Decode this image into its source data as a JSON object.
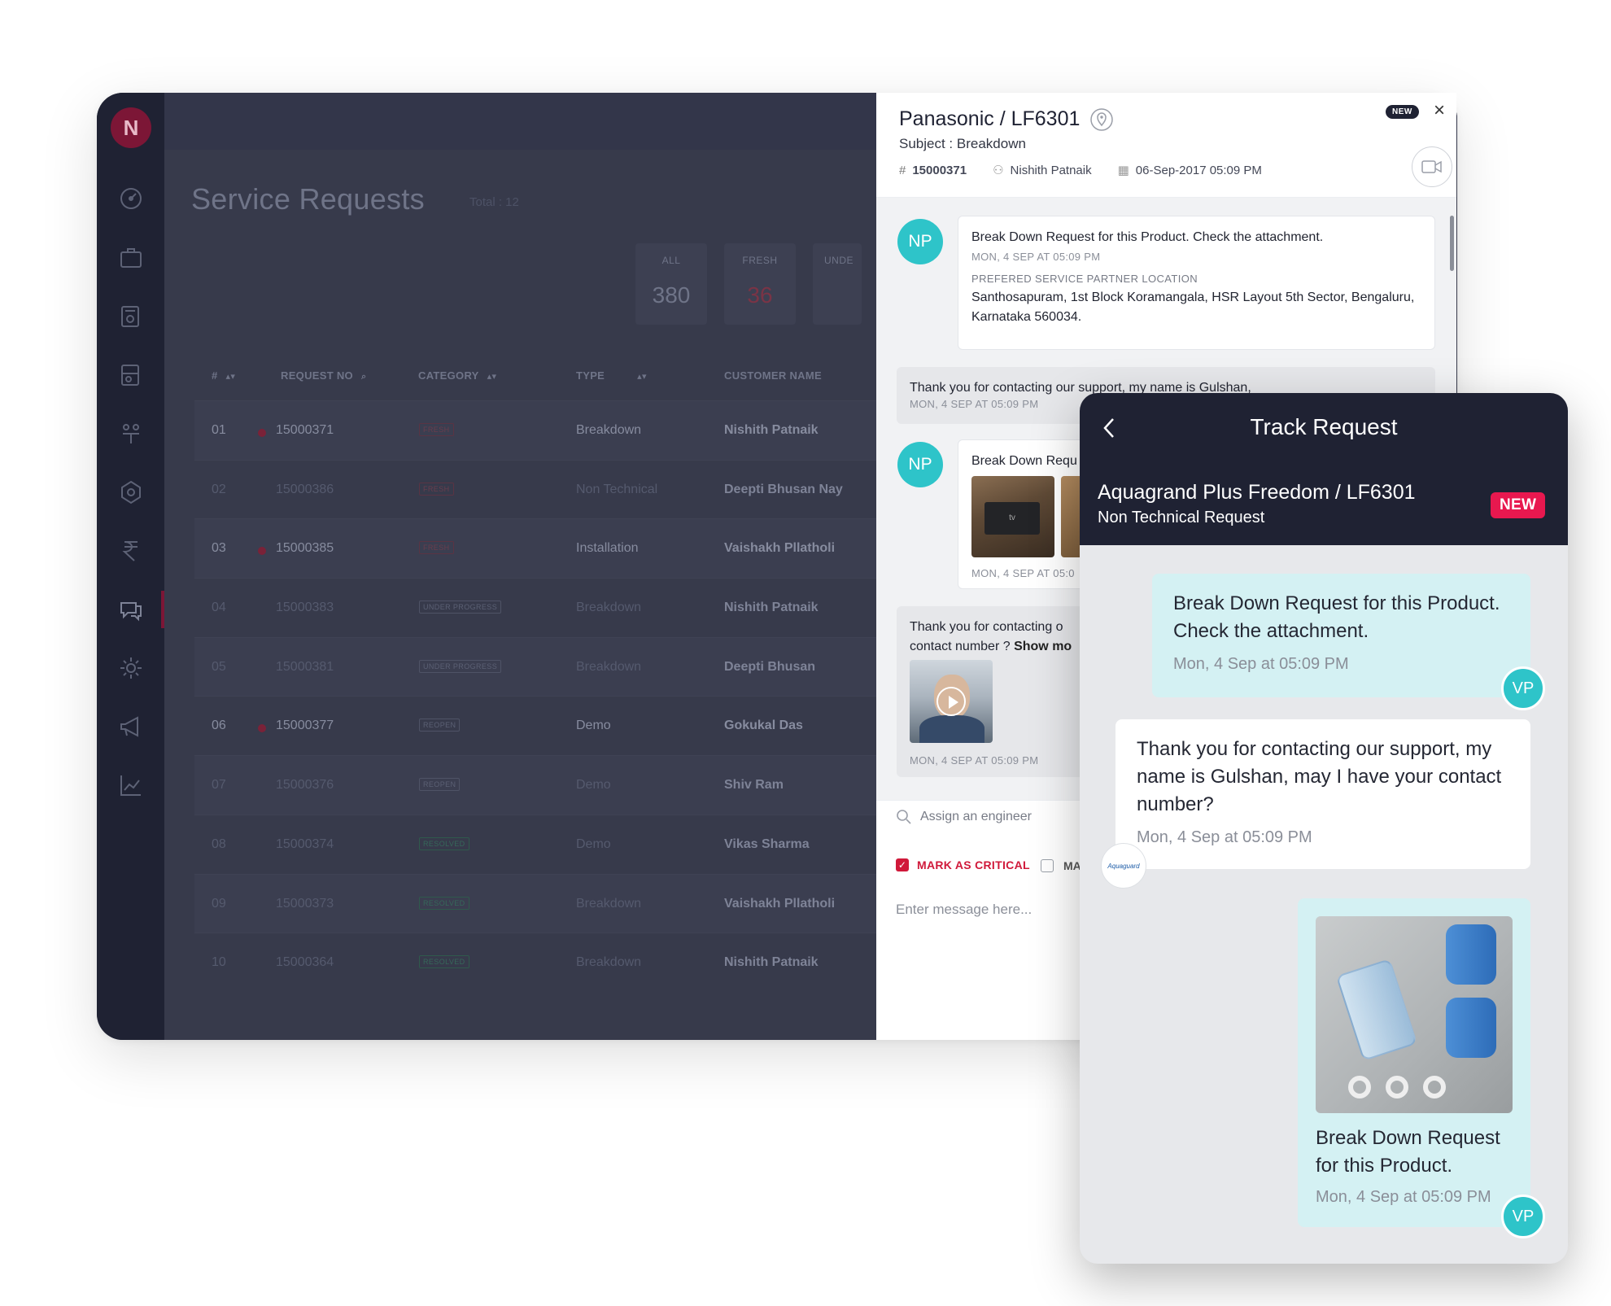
{
  "app": {
    "logo_letter": "N",
    "page_title": "Service Requests",
    "page_total": "Total : 12",
    "stats": [
      {
        "label": "ALL",
        "value": "380"
      },
      {
        "label": "FRESH",
        "value": "36"
      },
      {
        "label": "UNDE",
        "value": ""
      }
    ],
    "table": {
      "headers": [
        "#",
        "REQUEST NO",
        "CATEGORY",
        "TYPE",
        "CUSTOMER NAME"
      ],
      "rows": [
        {
          "num": "01",
          "request_no": "15000371",
          "category": "FRESH",
          "type": "Breakdown",
          "customer": "Nishith Patnaik"
        },
        {
          "num": "02",
          "request_no": "15000386",
          "category": "FRESH",
          "type": "Non Technical",
          "customer": "Deepti Bhusan Nay"
        },
        {
          "num": "03",
          "request_no": "15000385",
          "category": "FRESH",
          "type": "Installation",
          "customer": "Vaishakh Pllatholi"
        },
        {
          "num": "04",
          "request_no": "15000383",
          "category": "UNDER PROGRESS",
          "type": "Breakdown",
          "customer": "Nishith Patnaik"
        },
        {
          "num": "05",
          "request_no": "15000381",
          "category": "UNDER PROGRESS",
          "type": "Breakdown",
          "customer": "Deepti Bhusan"
        },
        {
          "num": "06",
          "request_no": "15000377",
          "category": "REOPEN",
          "type": "Demo",
          "customer": "Gokukal Das"
        },
        {
          "num": "07",
          "request_no": "15000376",
          "category": "REOPEN",
          "type": "Demo",
          "customer": "Shiv Ram"
        },
        {
          "num": "08",
          "request_no": "15000374",
          "category": "RESOLVED",
          "type": "Demo",
          "customer": "Vikas Sharma"
        },
        {
          "num": "09",
          "request_no": "15000373",
          "category": "RESOLVED",
          "type": "Breakdown",
          "customer": "Vaishakh Pllatholi"
        },
        {
          "num": "10",
          "request_no": "15000364",
          "category": "RESOLVED",
          "type": "Breakdown",
          "customer": "Nishith Patnaik"
        }
      ]
    }
  },
  "detail": {
    "title": "Panasonic / LF6301",
    "subject": "Subject : Breakdown",
    "request_no": "15000371",
    "customer": "Nishith Patnaik",
    "datetime": "06-Sep-2017 05:09 PM",
    "new_badge": "NEW",
    "close_glyph": "×",
    "messages": {
      "m1_avatar": "NP",
      "m1_text": "Break Down Request for this Product. Check the attachment.",
      "m1_time": "MON, 4 SEP AT 05:09 PM",
      "m1_label": "PREFERED SERVICE PARTNER LOCATION",
      "m1_address": "Santhosapuram, 1st Block Koramangala, HSR Layout 5th Sector, Bengaluru, Karnataka 560034.",
      "m2_text": "Thank you for contacting our support, my name is Gulshan,",
      "m2_time": "MON, 4 SEP AT 05:09 PM",
      "m3_avatar": "NP",
      "m3_text": "Break Down Requ",
      "m3_time": "MON, 4 SEP AT 05:0",
      "m3_tv": "tv",
      "m4_text": "Thank you for contacting o",
      "m4_text2": "contact number ?",
      "m4_more": "Show mo",
      "m4_time": "MON, 4 SEP AT 05:09 PM"
    },
    "assign_placeholder": "Assign an engineer",
    "mark_critical": "MARK AS CRITICAL",
    "second_checkbox": "MA",
    "message_placeholder": "Enter message here..."
  },
  "track": {
    "title": "Track Request",
    "product": "Aquagrand Plus Freedom / LF6301",
    "request_type": "Non Technical Request",
    "badge": "NEW",
    "messages": [
      {
        "text": "Break Down Request for this Product. Check the attachment.",
        "time": "Mon, 4 Sep at 05:09 PM",
        "avatar": "VP"
      },
      {
        "text": "Thank you for contacting our support, my name is Gulshan, may I have your contact number?",
        "time": "Mon, 4 Sep at 05:09 PM",
        "avatar": "Aquaguard"
      },
      {
        "text": "Break Down Request for this Product.",
        "time": "Mon, 4 Sep at 05:09 PM",
        "avatar": "VP"
      }
    ]
  }
}
